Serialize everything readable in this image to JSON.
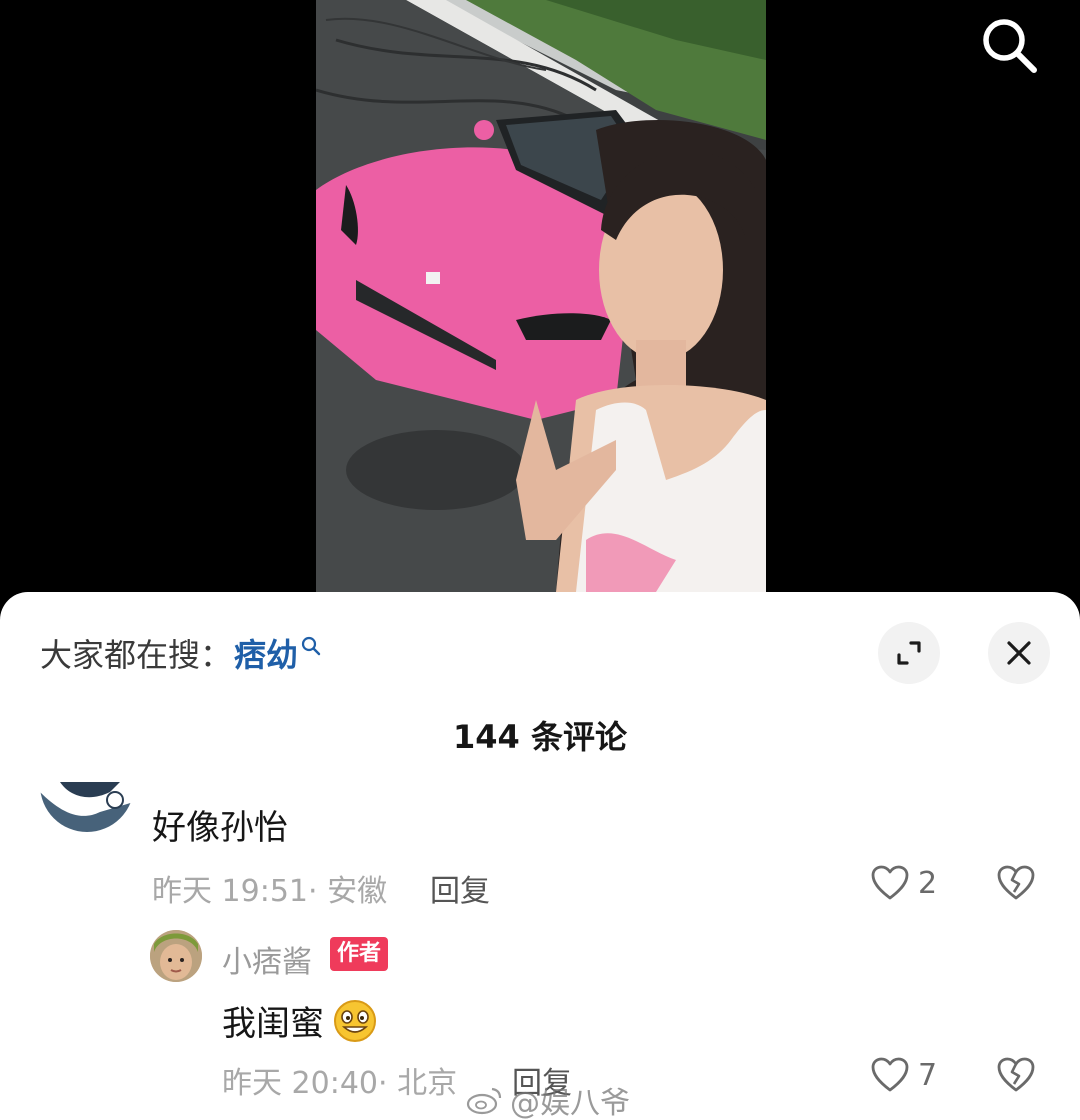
{
  "header": {
    "search_icon": "search-icon"
  },
  "sheet": {
    "suggest_prefix": "大家都在搜：",
    "suggest_keyword": "痞幼",
    "expand_icon": "expand-icon",
    "close_icon": "close-icon",
    "comment_count": "144 条评论"
  },
  "comments": [
    {
      "text": "好像孙怡",
      "meta": "昨天 19:51· 安徽",
      "reply_label": "回复",
      "likes": "2",
      "replies": [
        {
          "username": "小痞酱",
          "badge": "作者",
          "text": "我闺蜜",
          "emoji": "grinning-emoji",
          "meta": "昨天 20:40· 北京",
          "reply_label": "回复",
          "likes": "7"
        }
      ]
    }
  ],
  "watermark": "@娱八爷",
  "colors": {
    "accent_link": "#1f5fa8",
    "author_badge": "#ef3b5b",
    "car_pink": "#ec5fa4"
  }
}
